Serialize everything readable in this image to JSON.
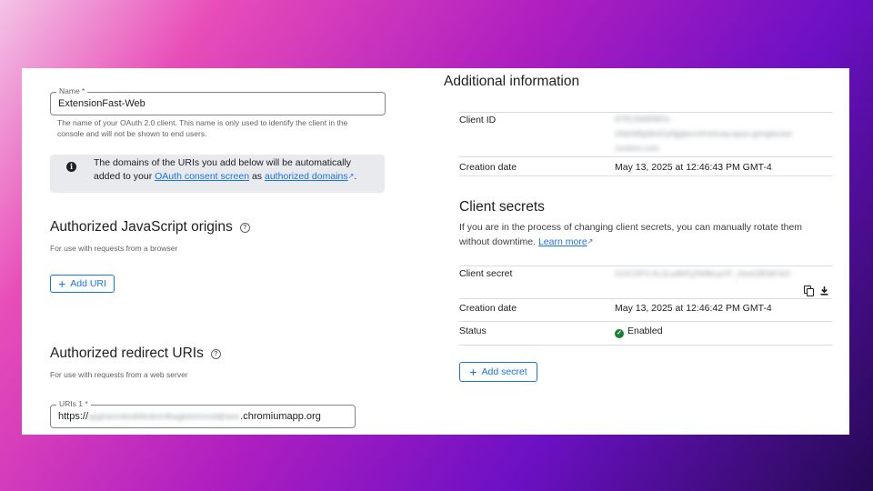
{
  "left": {
    "name_field": {
      "label": "Name *",
      "value": "ExtensionFast-Web",
      "helper": "The name of your OAuth 2.0 client. This name is only used to identify the client in the console and will not be shown to end users."
    },
    "info_box": {
      "text_before": "The domains of the URIs you add below will be automatically added to your ",
      "link1": "OAuth consent screen",
      "text_middle": " as ",
      "link2": "authorized domains",
      "text_after": "."
    },
    "js_origins": {
      "title": "Authorized JavaScript origins",
      "helper": "For use with requests from a browser",
      "add_button": "Add URI"
    },
    "redirect_uris": {
      "title": "Authorized redirect URIs",
      "helper": "For use with requests from a web server",
      "uri_label": "URIs 1 *",
      "uri_prefix": "https://",
      "uri_blurred": "apghanmkbdblbnkmnfbagkdohmnddjhaoc",
      "uri_suffix": ".chromiumapp.org"
    }
  },
  "right": {
    "additional_title": "Additional information",
    "client_id_label": "Client ID",
    "client_id_lines": [
      "878135889801-",
      "s9q0d8g9jhd1p9jjgtexmfnehuay.apps.googleuser",
      "content.com"
    ],
    "creation_date_label": "Creation date",
    "creation_date_value": "May 13, 2025 at 12:46:43 PM GMT-4",
    "secrets_title": "Client secrets",
    "secrets_desc": "If you are in the process of changing client secrets, you can manually rotate them without downtime. ",
    "learn_more": "Learn more",
    "client_secret_label": "Client secret",
    "client_secret_value": "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0",
    "secret_creation_label": "Creation date",
    "secret_creation_value": "May 13, 2025 at 12:46:42 PM GMT-4",
    "status_label": "Status",
    "status_value": "Enabled",
    "add_secret_button": "Add secret"
  },
  "icons": [
    "info-icon",
    "help-icon",
    "plus-icon",
    "external-link-icon",
    "copy-icon",
    "download-icon",
    "check-circle-icon"
  ],
  "colors": {
    "accent": "#1a73e8",
    "success": "#188038",
    "info_box_bg": "#e8eaed"
  }
}
